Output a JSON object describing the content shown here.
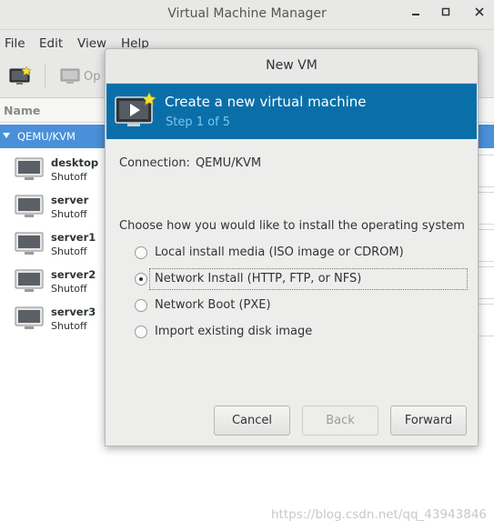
{
  "window": {
    "title": "Virtual Machine Manager"
  },
  "menu": {
    "items": [
      "File",
      "Edit",
      "View",
      "Help"
    ]
  },
  "toolbar": {
    "open_label": "Op"
  },
  "list": {
    "header": "Name",
    "connection": "QEMU/KVM",
    "vms": [
      {
        "name": "desktop",
        "state": "Shutoff"
      },
      {
        "name": "server",
        "state": "Shutoff"
      },
      {
        "name": "server1",
        "state": "Shutoff"
      },
      {
        "name": "server2",
        "state": "Shutoff"
      },
      {
        "name": "server3",
        "state": "Shutoff"
      }
    ]
  },
  "dialog": {
    "title": "New VM",
    "banner_title": "Create a new virtual machine",
    "banner_step": "Step 1 of 5",
    "connection_label": "Connection:",
    "connection_value": "QEMU/KVM",
    "choose_label": "Choose how you would like to install the operating system",
    "options": [
      {
        "label": "Local install media (ISO image or CDROM)",
        "selected": false
      },
      {
        "label": "Network Install (HTTP, FTP, or NFS)",
        "selected": true
      },
      {
        "label": "Network Boot (PXE)",
        "selected": false
      },
      {
        "label": "Import existing disk image",
        "selected": false
      }
    ],
    "buttons": {
      "cancel": "Cancel",
      "back": "Back",
      "forward": "Forward"
    }
  },
  "watermark": "https://blog.csdn.net/qq_43943846",
  "colors": {
    "accent": "#4a90d9",
    "banner": "#0a6fa9",
    "step_text": "#7fc4ec"
  }
}
